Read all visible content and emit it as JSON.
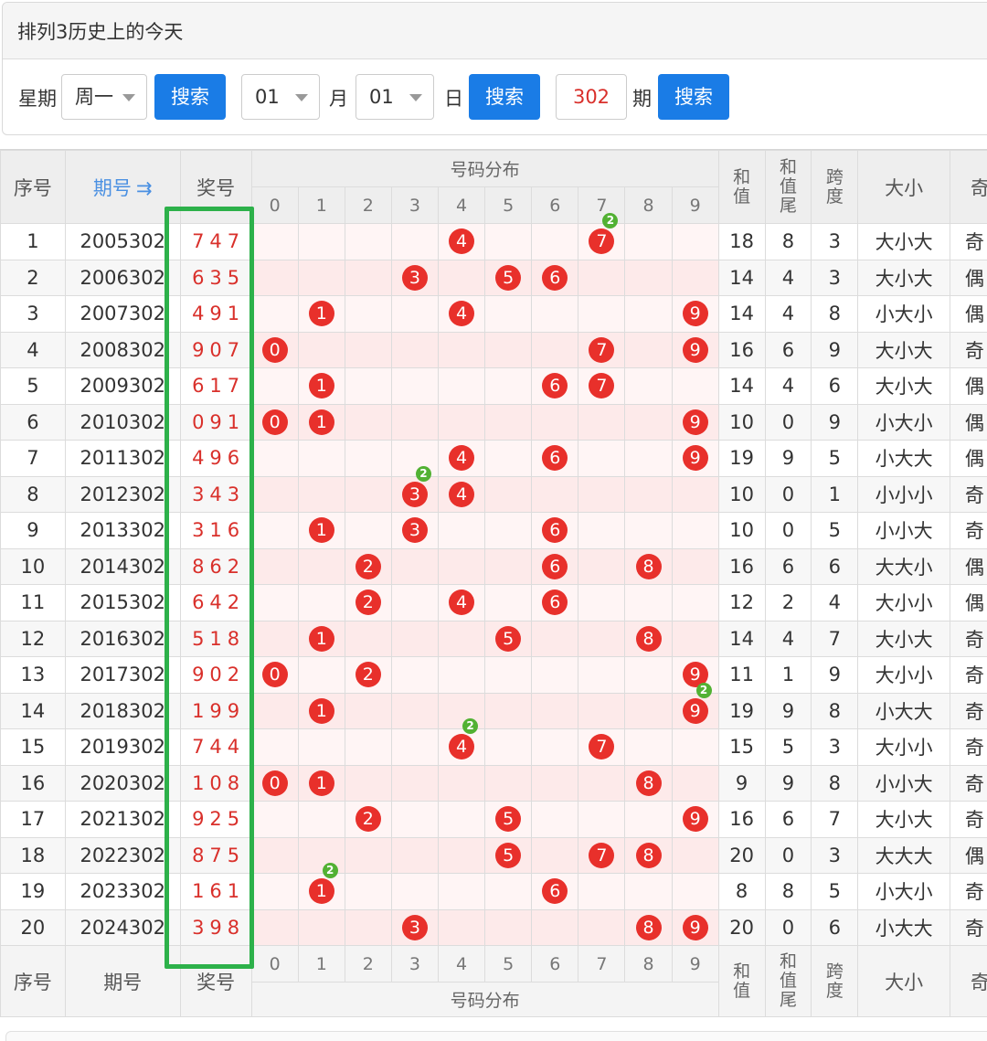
{
  "panel": {
    "title": "排列3历史上的今天"
  },
  "search": {
    "weekday_label": "星期",
    "weekday_value": "周一",
    "search_btn": "搜索",
    "month_value": "01",
    "month_label": "月",
    "day_value": "01",
    "day_label": "日",
    "issue_value": "302",
    "issue_label": "期"
  },
  "table": {
    "headers": {
      "seq": "序号",
      "issue": "期号",
      "sort_icon": "⇉",
      "prize": "奖号",
      "distribution": "号码分布",
      "sum": "和值",
      "sum_tail": "和值尾",
      "span": "跨度",
      "size": "大小",
      "parity": "奇"
    },
    "digits": [
      "0",
      "1",
      "2",
      "3",
      "4",
      "5",
      "6",
      "7",
      "8",
      "9"
    ],
    "rows": [
      {
        "seq": "1",
        "issue": "2005302",
        "prize": "747",
        "sum": "18",
        "tail": "8",
        "span": "3",
        "size": "大小大",
        "parity": "奇"
      },
      {
        "seq": "2",
        "issue": "2006302",
        "prize": "635",
        "sum": "14",
        "tail": "4",
        "span": "3",
        "size": "大小大",
        "parity": "偶"
      },
      {
        "seq": "3",
        "issue": "2007302",
        "prize": "491",
        "sum": "14",
        "tail": "4",
        "span": "8",
        "size": "小大小",
        "parity": "偶"
      },
      {
        "seq": "4",
        "issue": "2008302",
        "prize": "907",
        "sum": "16",
        "tail": "6",
        "span": "9",
        "size": "大小大",
        "parity": "奇"
      },
      {
        "seq": "5",
        "issue": "2009302",
        "prize": "617",
        "sum": "14",
        "tail": "4",
        "span": "6",
        "size": "大小大",
        "parity": "偶"
      },
      {
        "seq": "6",
        "issue": "2010302",
        "prize": "091",
        "sum": "10",
        "tail": "0",
        "span": "9",
        "size": "小大小",
        "parity": "偶"
      },
      {
        "seq": "7",
        "issue": "2011302",
        "prize": "496",
        "sum": "19",
        "tail": "9",
        "span": "5",
        "size": "小大大",
        "parity": "偶"
      },
      {
        "seq": "8",
        "issue": "2012302",
        "prize": "343",
        "sum": "10",
        "tail": "0",
        "span": "1",
        "size": "小小小",
        "parity": "奇"
      },
      {
        "seq": "9",
        "issue": "2013302",
        "prize": "316",
        "sum": "10",
        "tail": "0",
        "span": "5",
        "size": "小小大",
        "parity": "奇"
      },
      {
        "seq": "10",
        "issue": "2014302",
        "prize": "862",
        "sum": "16",
        "tail": "6",
        "span": "6",
        "size": "大大小",
        "parity": "偶"
      },
      {
        "seq": "11",
        "issue": "2015302",
        "prize": "642",
        "sum": "12",
        "tail": "2",
        "span": "4",
        "size": "大小小",
        "parity": "偶"
      },
      {
        "seq": "12",
        "issue": "2016302",
        "prize": "518",
        "sum": "14",
        "tail": "4",
        "span": "7",
        "size": "大小大",
        "parity": "奇"
      },
      {
        "seq": "13",
        "issue": "2017302",
        "prize": "902",
        "sum": "11",
        "tail": "1",
        "span": "9",
        "size": "大小小",
        "parity": "奇"
      },
      {
        "seq": "14",
        "issue": "2018302",
        "prize": "199",
        "sum": "19",
        "tail": "9",
        "span": "8",
        "size": "小大大",
        "parity": "奇"
      },
      {
        "seq": "15",
        "issue": "2019302",
        "prize": "744",
        "sum": "15",
        "tail": "5",
        "span": "3",
        "size": "大小小",
        "parity": "奇"
      },
      {
        "seq": "16",
        "issue": "2020302",
        "prize": "108",
        "sum": "9",
        "tail": "9",
        "span": "8",
        "size": "小小大",
        "parity": "奇"
      },
      {
        "seq": "17",
        "issue": "2021302",
        "prize": "925",
        "sum": "16",
        "tail": "6",
        "span": "7",
        "size": "大小大",
        "parity": "奇"
      },
      {
        "seq": "18",
        "issue": "2022302",
        "prize": "875",
        "sum": "20",
        "tail": "0",
        "span": "3",
        "size": "大大大",
        "parity": "偶"
      },
      {
        "seq": "19",
        "issue": "2023302",
        "prize": "161",
        "sum": "8",
        "tail": "8",
        "span": "5",
        "size": "小大小",
        "parity": "奇"
      },
      {
        "seq": "20",
        "issue": "2024302",
        "prize": "398",
        "sum": "20",
        "tail": "0",
        "span": "6",
        "size": "小大大",
        "parity": "奇"
      }
    ]
  },
  "colors": {
    "accent": "#1a7ce6",
    "ball": "#e8302b",
    "count_badge": "#52b133",
    "highlight_box": "#2db14a"
  }
}
